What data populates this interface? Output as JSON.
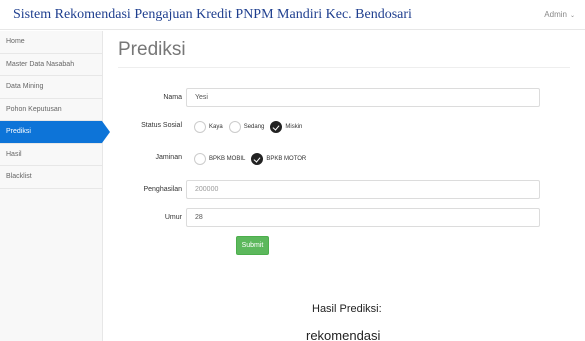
{
  "header": {
    "title": "Sistem Rekomendasi Pengajuan Kredit PNPM Mandiri Kec. Bendosari",
    "user_label": "Admin",
    "user_caret": "⌄"
  },
  "sidebar": {
    "items": [
      {
        "label": "Home"
      },
      {
        "label": "Master Data Nasabah"
      },
      {
        "label": "Data Mining"
      },
      {
        "label": "Pohon Keputusan"
      },
      {
        "label": "Prediksi"
      },
      {
        "label": "Hasil"
      },
      {
        "label": "Blacklist"
      }
    ],
    "active_index": 4
  },
  "main": {
    "title": "Prediksi",
    "form": {
      "nama": {
        "label": "Nama",
        "value": "Yesi"
      },
      "status_sosial": {
        "label": "Status Sosial",
        "options": [
          "Kaya",
          "Sedang",
          "Miskin"
        ],
        "selected": "Miskin"
      },
      "jaminan": {
        "label": "Jaminan",
        "options": [
          "BPKB MOBIL",
          "BPKB MOTOR"
        ],
        "selected": "BPKB MOTOR"
      },
      "penghasilan": {
        "label": "Penghasilan",
        "value": "200000"
      },
      "umur": {
        "label": "Umur",
        "value": "28"
      },
      "submit_label": "Submit"
    },
    "result": {
      "title": "Hasil Prediksi:",
      "value": "rekomendasi"
    }
  },
  "colors": {
    "active": "#0d74d8",
    "submit": "#5cb85c",
    "brand": "#1f3f8f"
  }
}
